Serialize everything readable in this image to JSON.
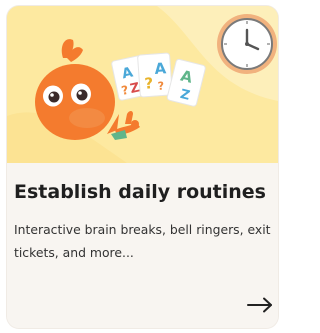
{
  "card": {
    "title": "Establish daily routines",
    "description": "Interactive brain breaks, bell ringers, exit tickets, and more...",
    "arrow_icon": "arrow-right-icon",
    "illustration_icons": [
      "clock-icon",
      "mascot-icon",
      "letter-cards-icon"
    ],
    "card_letters": [
      "A",
      "?",
      "Z",
      "?",
      "A",
      "?",
      "A",
      "Z"
    ]
  },
  "colors": {
    "hero_background": "#fde9a0",
    "mascot": "#f47b2e",
    "body_background": "#f8f5f1",
    "title": "#1f1f1f"
  }
}
